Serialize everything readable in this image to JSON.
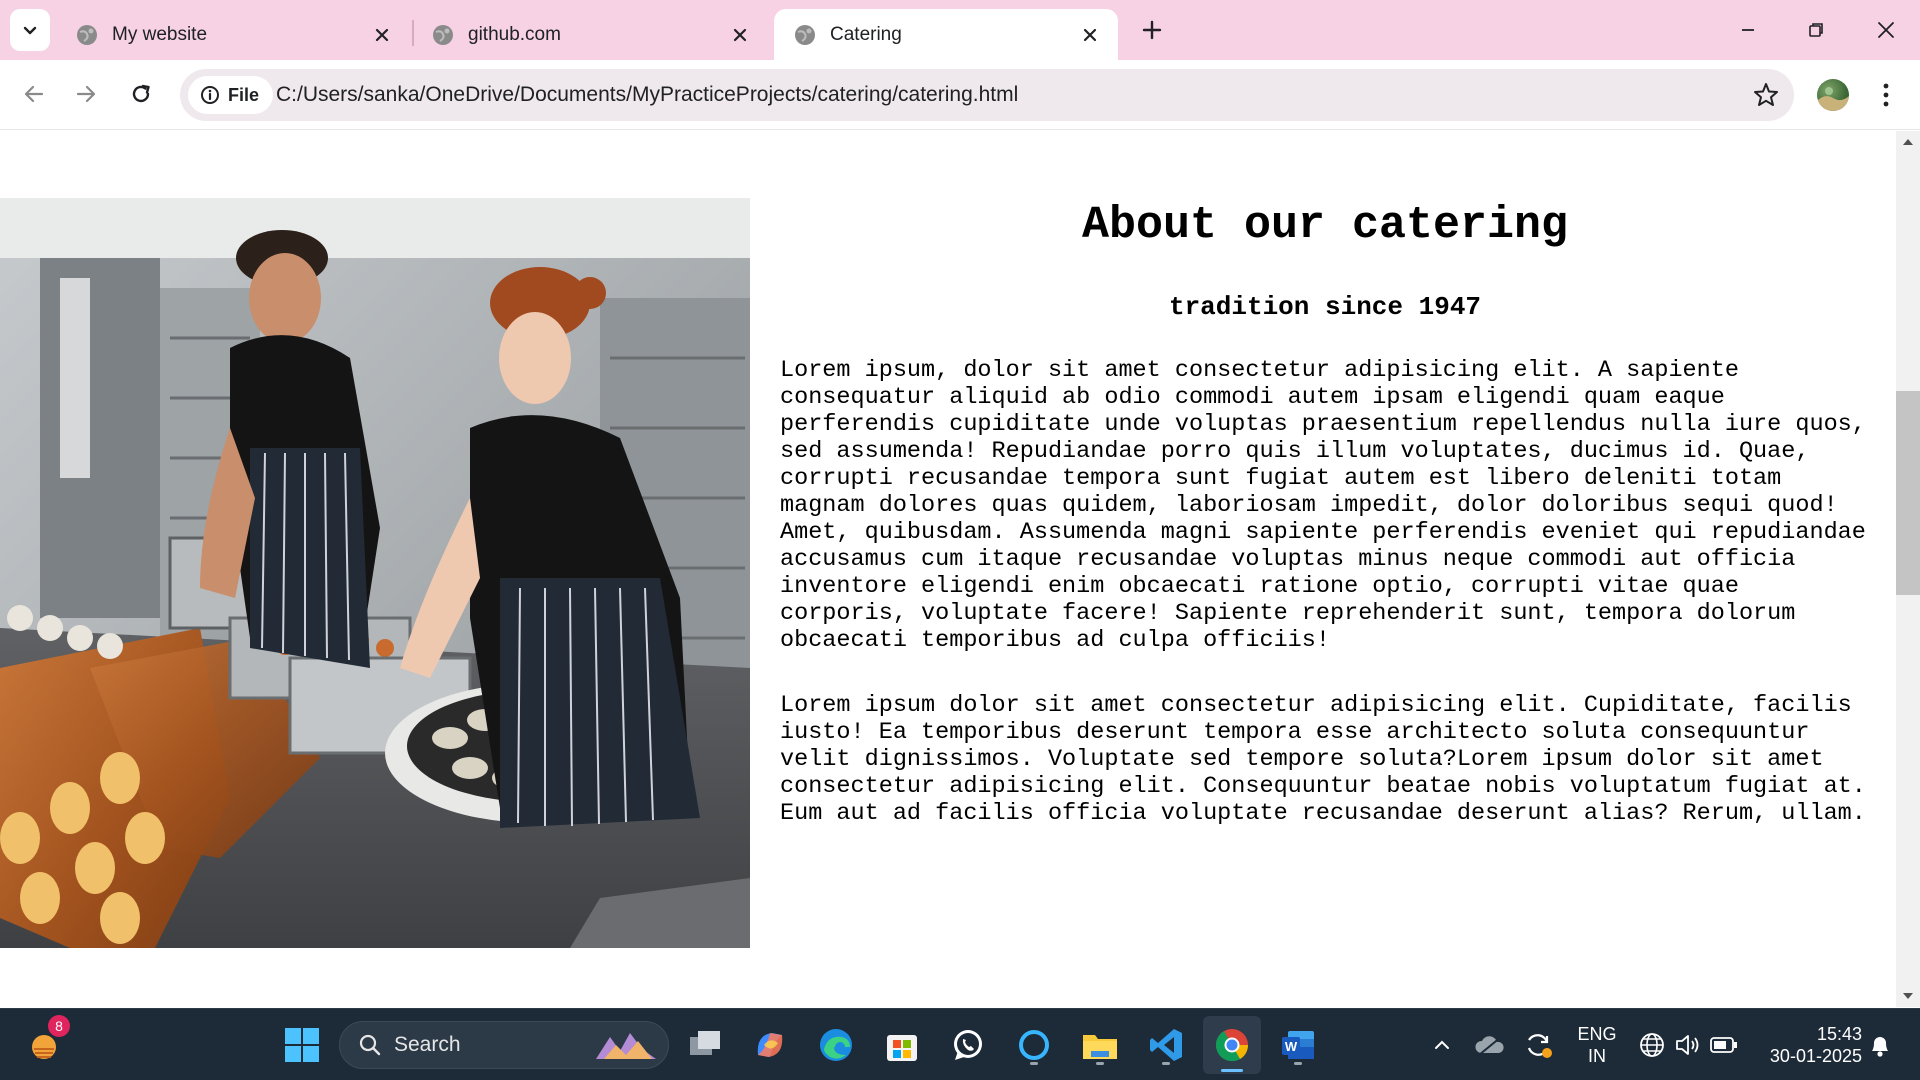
{
  "browser": {
    "tabs": [
      {
        "title": "My website",
        "active": false
      },
      {
        "title": "github.com",
        "active": false
      },
      {
        "title": "Catering",
        "active": true
      }
    ],
    "address": {
      "chip_label": "File",
      "url": "C:/Users/sanka/OneDrive/Documents/MyPracticeProjects/catering/catering.html"
    }
  },
  "page": {
    "title": "About our catering",
    "subtitle": "tradition since 1947",
    "paragraphs": [
      "Lorem ipsum, dolor sit amet consectetur adipisicing elit. A sapiente consequatur aliquid ab odio commodi autem ipsam eligendi quam eaque perferendis cupiditate unde voluptas praesentium repellendus nulla iure quos, sed assumenda! Repudiandae porro quis illum voluptates, ducimus id. Quae, corrupti recusandae tempora sunt fugiat autem est libero deleniti totam magnam dolores quas quidem, laboriosam impedit, dolor doloribus sequi quod! Amet, quibusdam. Assumenda magni sapiente perferendis eveniet qui repudiandae accusamus cum itaque recusandae voluptas minus neque commodi aut officia inventore eligendi enim obcaecati ratione optio, corrupti vitae quae corporis, voluptate facere! Sapiente reprehenderit sunt, tempora dolorum obcaecati temporibus ad culpa officiis!",
      "Lorem ipsum dolor sit amet consectetur adipisicing elit. Cupiditate, facilis iusto! Ea temporibus deserunt tempora esse architecto soluta consequuntur velit dignissimos. Voluptate sed tempore soluta?Lorem ipsum dolor sit amet consectetur adipisicing elit. Consequuntur beatae nobis voluptatum fugiat at. Eum aut ad facilis officia voluptate recusandae deserunt alias? Rerum, ullam."
    ]
  },
  "taskbar": {
    "search_label": "Search",
    "widgets_badge": "8",
    "language": "ENG",
    "region": "IN",
    "time": "15:43",
    "date": "30-01-2025",
    "pinned": [
      "windows-start",
      "task-view",
      "copilot",
      "edge",
      "microsoft-store",
      "whatsapp",
      "cortana",
      "file-explorer",
      "vscode",
      "chrome",
      "word"
    ]
  },
  "colors": {
    "tabstrip": "#f6d2e4",
    "omnibox": "#efe9ee",
    "taskbar": "#1d2a38"
  }
}
